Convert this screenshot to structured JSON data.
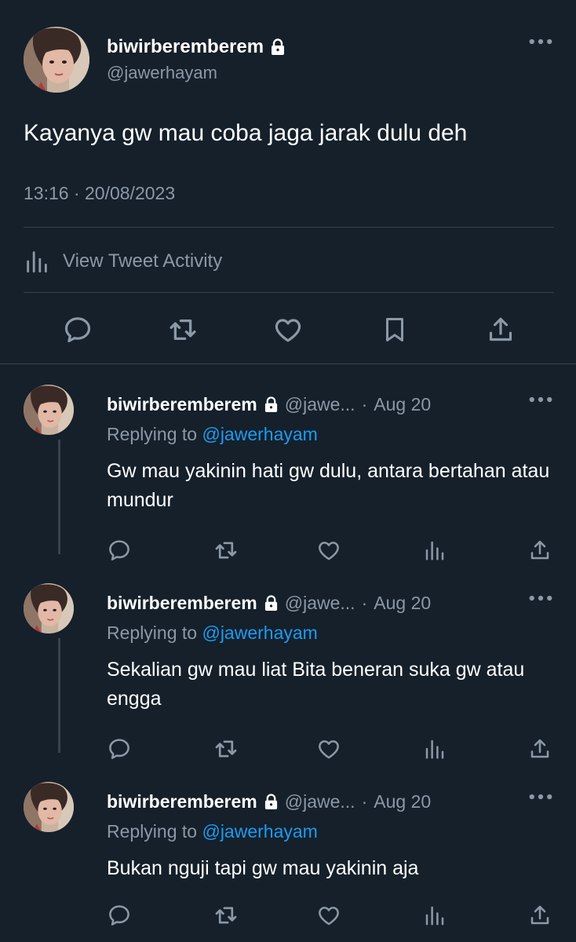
{
  "main_tweet": {
    "name": "biwirberemberem",
    "handle": "@jawerhayam",
    "text": "Kayanya gw mau coba jaga jarak dulu deh",
    "timestamp": "13:16 · 20/08/2023",
    "activity_label": "View Tweet Activity",
    "icons": [
      "reply-icon",
      "retweet-icon",
      "like-icon",
      "bookmark-icon",
      "share-icon"
    ]
  },
  "replies": [
    {
      "name": "biwirberemberem",
      "handle": "@jawe...",
      "dot": "·",
      "time": "Aug 20",
      "replying_prefix": "Replying to ",
      "replying_to": "@jawerhayam",
      "body": "Gw mau yakinin hati gw dulu, antara bertahan atau mundur"
    },
    {
      "name": "biwirberemberem",
      "handle": "@jawe...",
      "dot": "·",
      "time": "Aug 20",
      "replying_prefix": "Replying to ",
      "replying_to": "@jawerhayam",
      "body": "Sekalian gw mau liat Bita beneran suka gw atau engga"
    },
    {
      "name": "biwirberemberem",
      "handle": "@jawe...",
      "dot": "·",
      "time": "Aug 20",
      "replying_prefix": "Replying to ",
      "replying_to": "@jawerhayam",
      "body": "Bukan nguji tapi gw mau yakinin aja"
    }
  ],
  "colors": {
    "background": "#15202b",
    "text": "#ffffff",
    "muted": "#8b98a5",
    "accent": "#1d9bf0",
    "divider": "#38444d"
  }
}
